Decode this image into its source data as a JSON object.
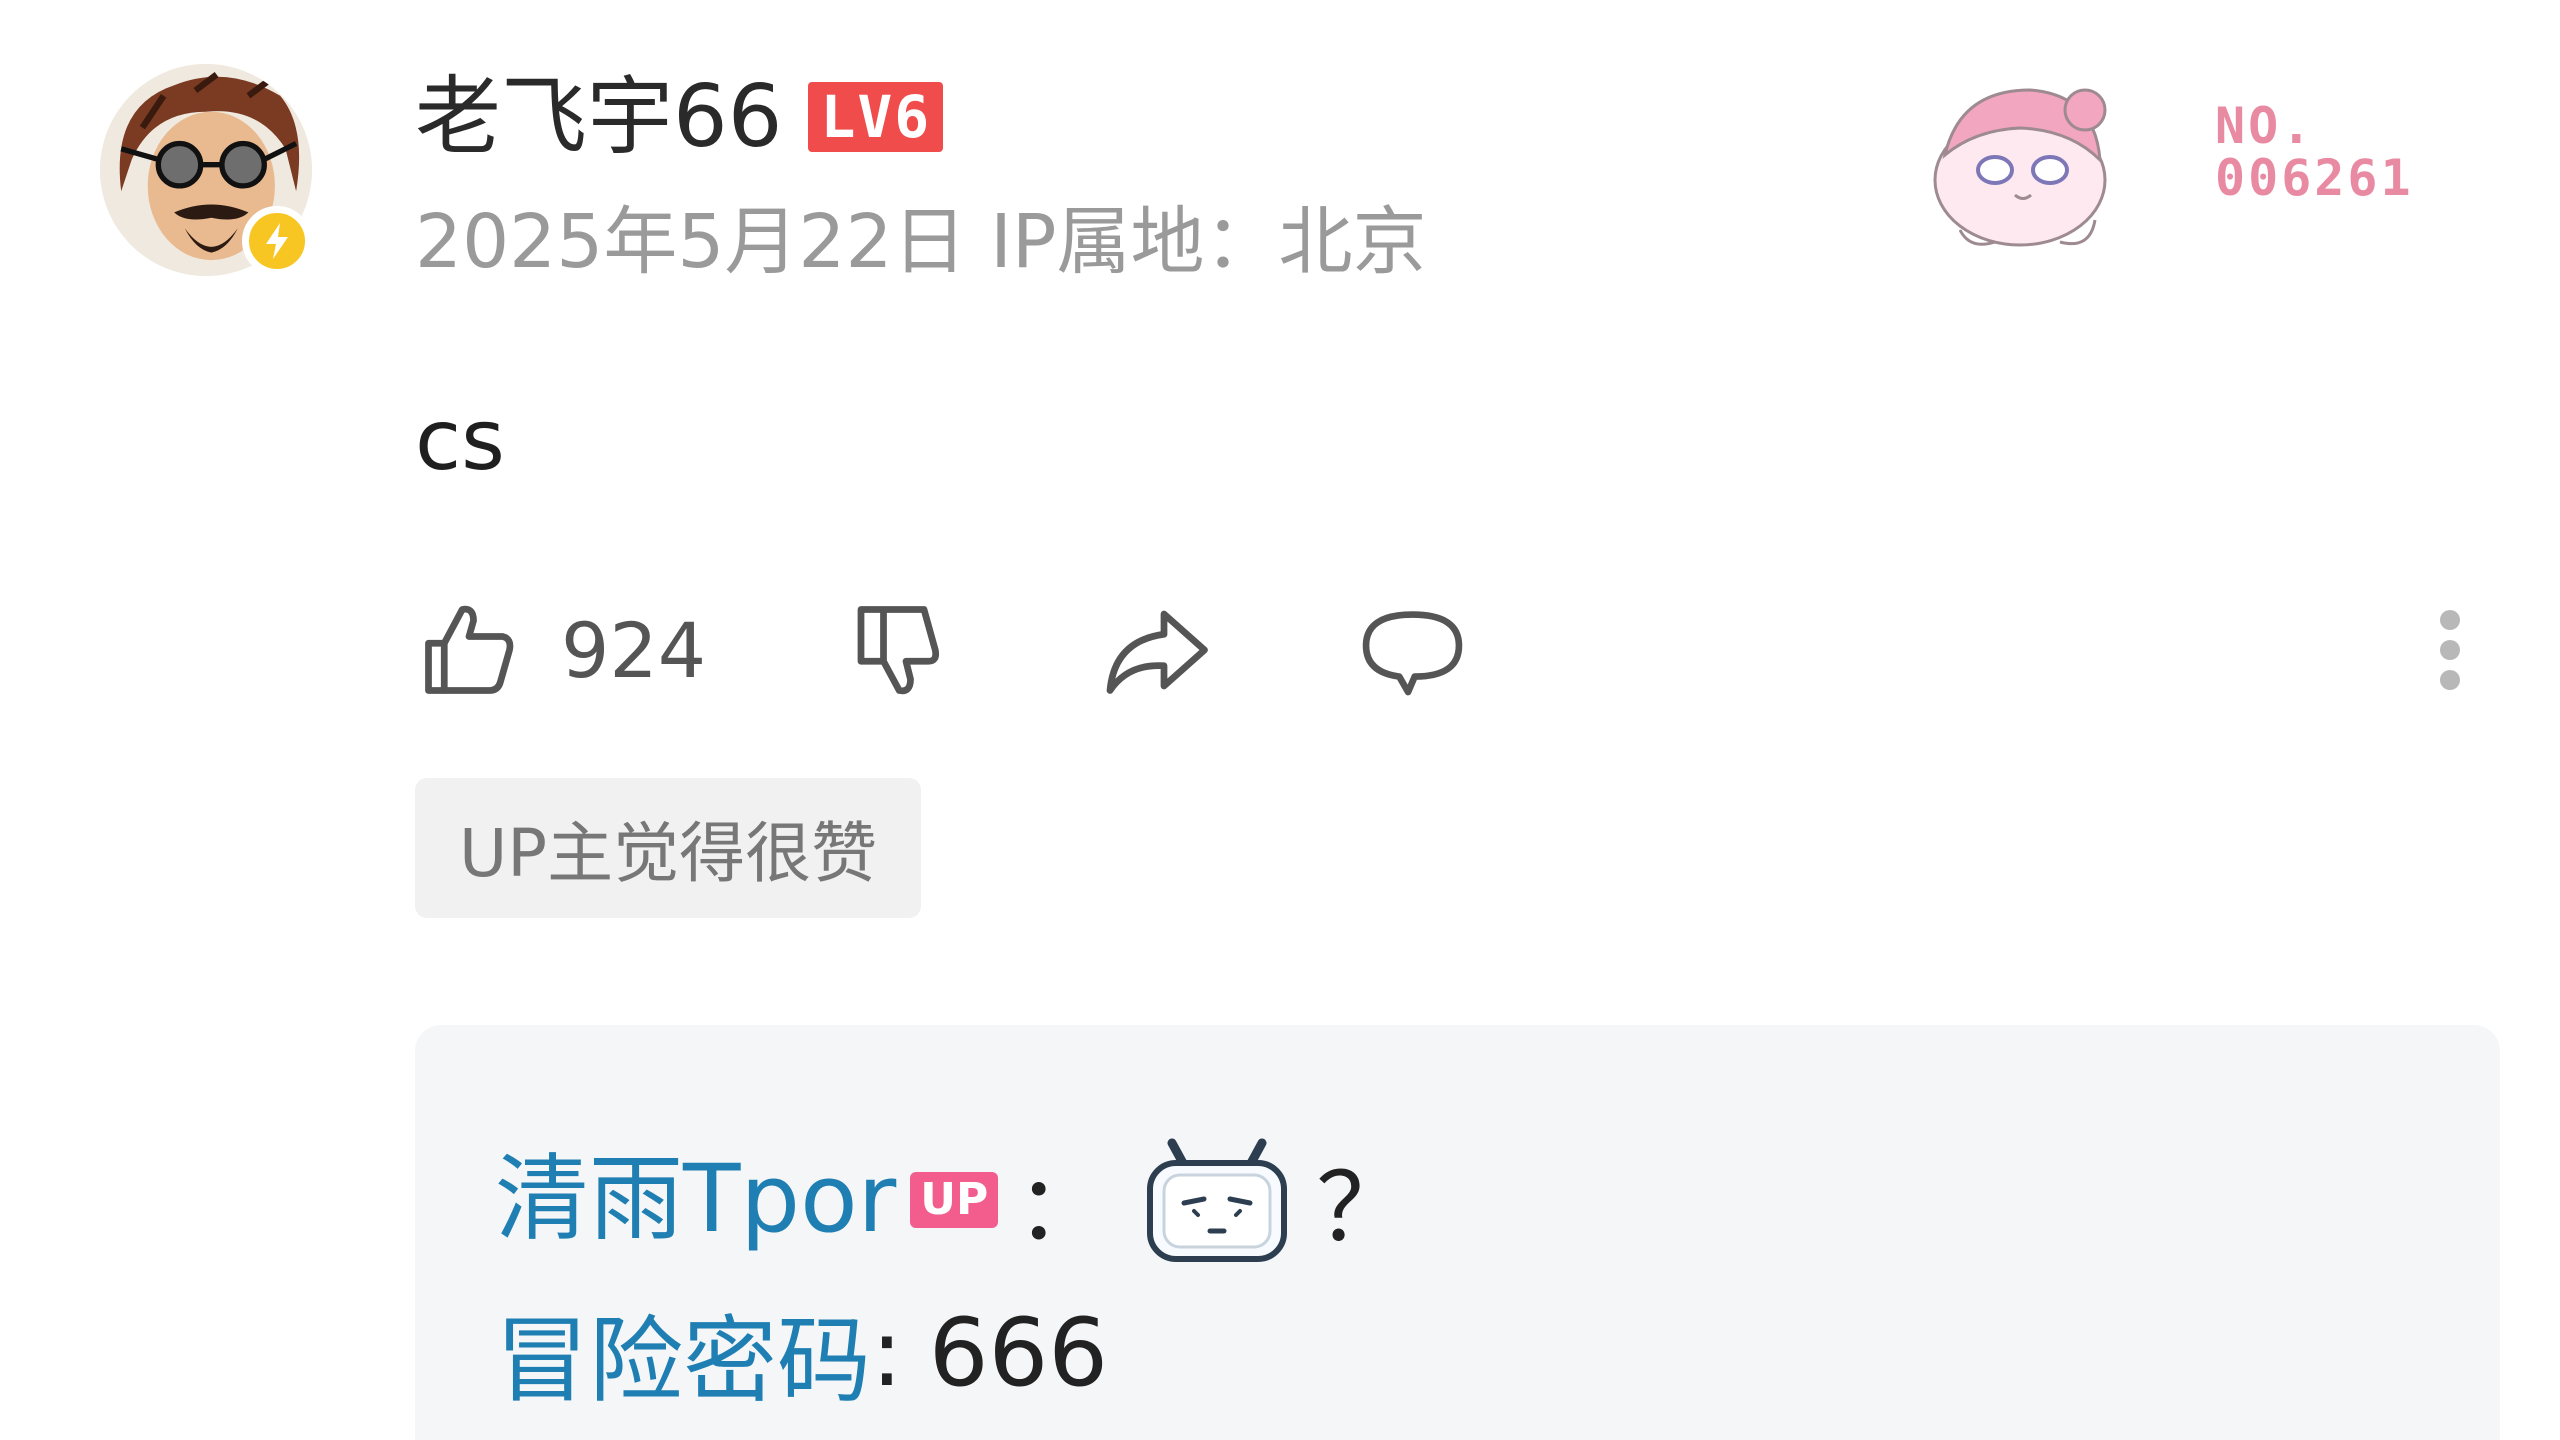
{
  "comment": {
    "user": {
      "name": "老飞宇66",
      "level": "LV6",
      "avatar_icon": "sunglasses-man-avatar",
      "verified_icon": "lightning-icon",
      "verified_color": "#f7c623"
    },
    "meta": {
      "date": "2025年5月22日",
      "ip_location": "IP属地：北京"
    },
    "fan_card": {
      "icon": "anime-girl-fan-card",
      "label": "NO.",
      "number": "006261",
      "color": "#e98aa3"
    },
    "text": "cs",
    "actions": {
      "like_count": "924",
      "like_icon": "thumbs-up-icon",
      "dislike_icon": "thumbs-down-icon",
      "share_icon": "share-icon",
      "reply_icon": "comment-bubble-icon",
      "more_icon": "more-vertical-icon"
    },
    "tag": "UP主觉得很赞"
  },
  "reply_preview": {
    "author": "清雨Tpor",
    "author_badge": "UP",
    "colon": "：",
    "emote_icon": "bilibili-tv-emote",
    "text": "？",
    "code_label": "冒险密码",
    "code_sep": ":",
    "code_value": "666",
    "name_color": "#1f7fb3",
    "badge_color": "#f25d8e"
  }
}
